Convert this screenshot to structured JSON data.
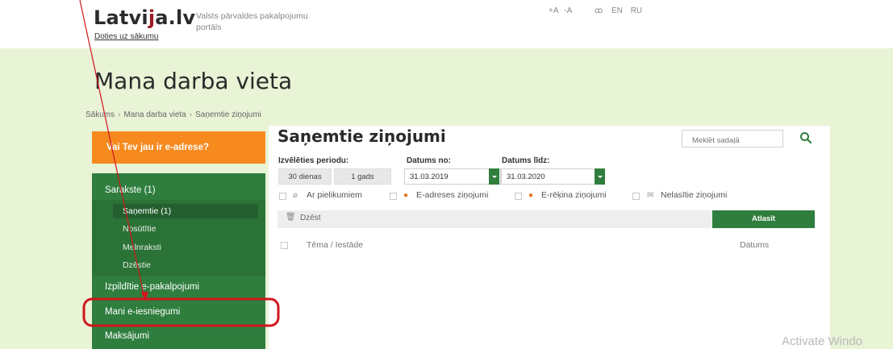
{
  "header": {
    "logo_text_pre": "Latvi",
    "logo_text_j": "j",
    "logo_text_post": "a.lv",
    "tagline": "Valsts pārvaldes pakalpojumu portāls",
    "home_link": "Doties uz sākumu",
    "font_controls": [
      "+A",
      "-A"
    ],
    "glasses_icon": "ꝏ",
    "languages": [
      "EN",
      "RU"
    ]
  },
  "page": {
    "title": "Mana darba vieta",
    "breadcrumb": [
      "Sākums",
      "Mana darba vieta",
      "Saņemtie ziņojumi"
    ],
    "breadcrumb_sep": "›"
  },
  "sidebar": {
    "eaddress_banner": "Vai Tev jau ir e-adrese?",
    "items": {
      "sarakste": "Sarakste (1)",
      "sanemtie": "Saņemtie (1)",
      "nosutitie": "Nosūtītie",
      "melnraksti": "Melnraksti",
      "dzestie": "Dzēstie",
      "izpilditie": "Izpildītie e-pakalpojumi",
      "iesniegumi": "Mani e-iesniegumi",
      "maksajumi": "Maksājumi"
    }
  },
  "main": {
    "title": "Saņemtie ziņojumi",
    "search_placeholder": "Meklēt sadaļā",
    "period_label": "Izvēlēties periodu:",
    "from_label": "Datums no:",
    "to_label": "Datums līdz:",
    "period_buttons": [
      "30 dienas",
      "1 gads"
    ],
    "date_from": "31.03.2019",
    "date_to": "31.03.2020",
    "filters": [
      "Ar pielikumiem",
      "E-adreses ziņojumi",
      "E-rēķina ziņojumi",
      "Nelasītie ziņojumi"
    ],
    "delete_label": "Dzēst",
    "filter_button": "Atlasīt",
    "columns": [
      "Tēma / Iestāde",
      "Datums"
    ]
  },
  "watermark": "Activate Windo",
  "colors": {
    "green": "#2f7e3e",
    "orange": "#f68a1f",
    "band": "#e9f3d6",
    "annotation": "#d0161b"
  }
}
